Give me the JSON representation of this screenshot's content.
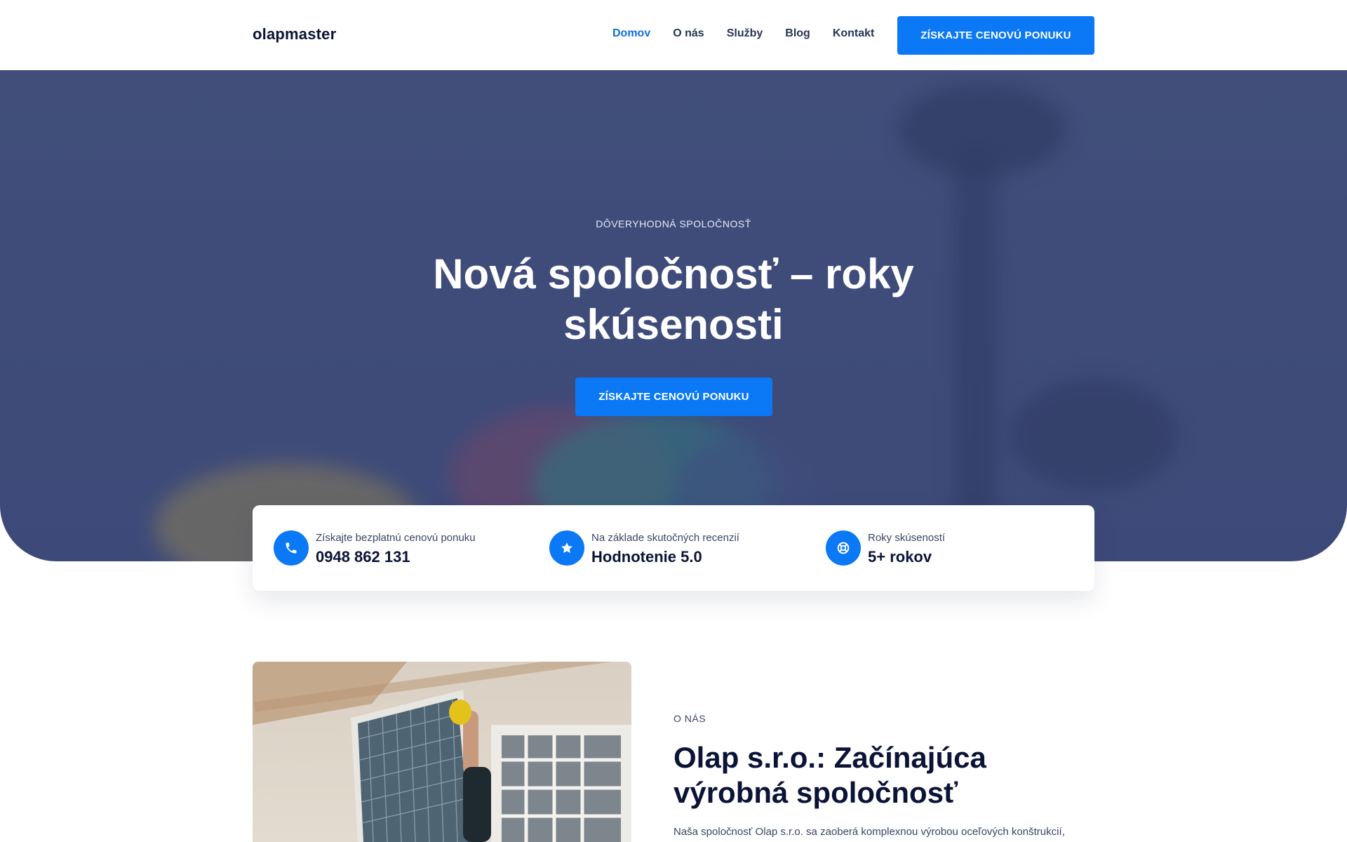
{
  "header": {
    "logo": "olapmaster",
    "nav": [
      {
        "label": "Domov",
        "active": true
      },
      {
        "label": "O nás",
        "active": false
      },
      {
        "label": "Služby",
        "active": false
      },
      {
        "label": "Blog",
        "active": false
      },
      {
        "label": "Kontakt",
        "active": false
      }
    ],
    "cta_label": "ZÍSKAJTE CENOVÚ PONUKU"
  },
  "hero": {
    "kicker": "DÔVERYHODNÁ SPOLOČNOSŤ",
    "title": "Nová spoločnosť – roky skúsenosti",
    "cta_label": "ZÍSKAJTE CENOVÚ PONUKU"
  },
  "stats": [
    {
      "icon": "phone-icon",
      "label": "Získajte bezplatnú cenovú ponuku",
      "value": "0948 862 131"
    },
    {
      "icon": "star-icon",
      "label": "Na základe skutočných recenzií",
      "value": "Hodnotenie 5.0"
    },
    {
      "icon": "lifebuoy-icon",
      "label": "Roky skúseností",
      "value": "5+ rokov"
    }
  ],
  "about": {
    "kicker": "O NÁS",
    "title": "Olap s.r.o.: Začínajúca výrobná spoločnosť",
    "text": "Naša spoločnosť Olap s.r.o. sa zaoberá komplexnou výrobou oceľových konštrukcií,"
  },
  "colors": {
    "accent": "#0b78f5",
    "nav_active": "#0d6ee0",
    "heading": "#0b1437",
    "hero_overlay": "#4a5680"
  }
}
